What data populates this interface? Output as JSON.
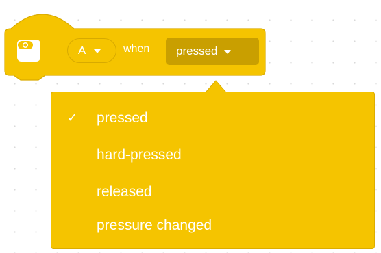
{
  "block": {
    "icon": "hub-button-icon",
    "port_value": "A",
    "when_label": "when",
    "event_value": "pressed",
    "color": "#f5c400"
  },
  "menu": {
    "check_glyph": "✓",
    "items": [
      {
        "label": "pressed",
        "selected": true
      },
      {
        "label": "hard-pressed",
        "selected": false
      },
      {
        "label": "released",
        "selected": false
      },
      {
        "label": "pressure changed",
        "selected": false
      }
    ]
  }
}
